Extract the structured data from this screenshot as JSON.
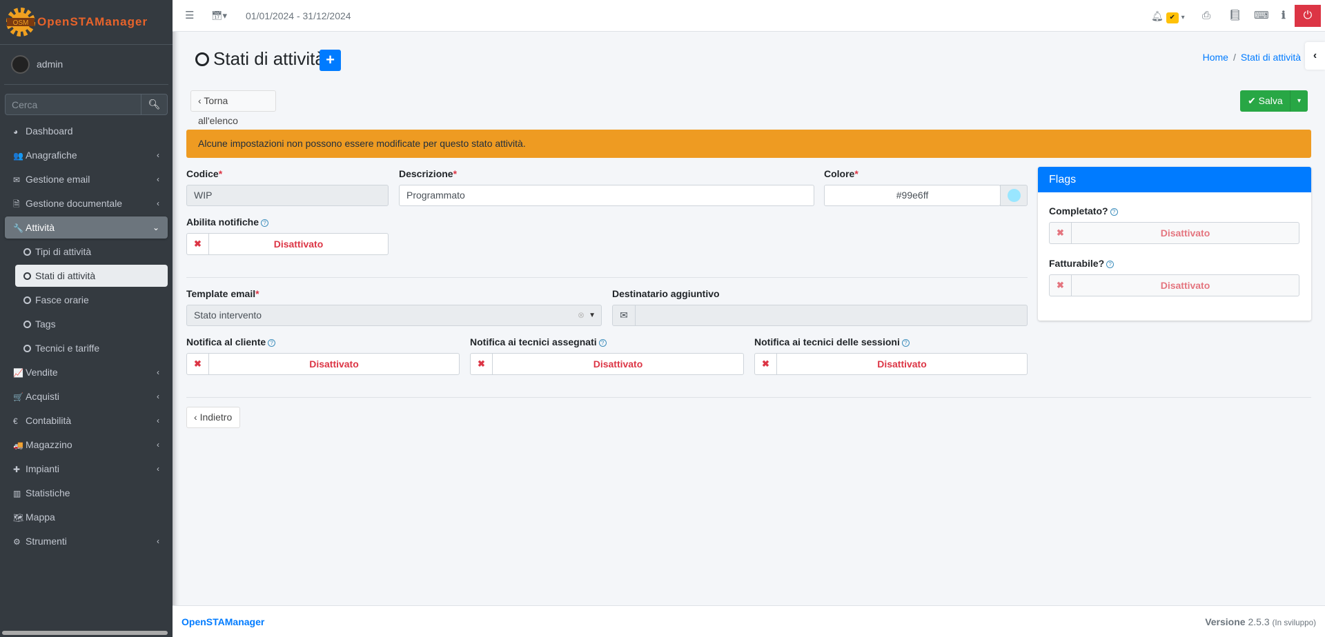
{
  "app": {
    "logo_text": "OpenSTAManager",
    "logo_badge": "OSM"
  },
  "user": {
    "name": "admin"
  },
  "search": {
    "placeholder": "Cerca"
  },
  "sidebar": {
    "items": [
      {
        "label": "Dashboard",
        "icon": "dashboard-icon",
        "glyph": "◕",
        "chevron": ""
      },
      {
        "label": "Anagrafiche",
        "icon": "users-icon",
        "glyph": "👥",
        "chevron": "‹"
      },
      {
        "label": "Gestione email",
        "icon": "envelope-icon",
        "glyph": "✉",
        "chevron": "‹"
      },
      {
        "label": "Gestione documentale",
        "icon": "file-icon",
        "glyph": "🗎",
        "chevron": "‹"
      },
      {
        "label": "Attività",
        "icon": "wrench-icon",
        "glyph": "🔧",
        "chevron": "⌄",
        "active": true
      },
      {
        "label": "Tipi di attività",
        "sub": true
      },
      {
        "label": "Stati di attività",
        "sub": true,
        "selected": true
      },
      {
        "label": "Fasce orarie",
        "sub": true
      },
      {
        "label": "Tags",
        "sub": true
      },
      {
        "label": "Tecnici e tariffe",
        "sub": true
      },
      {
        "label": "Vendite",
        "icon": "chart-line-icon",
        "glyph": "📈",
        "chevron": "‹"
      },
      {
        "label": "Acquisti",
        "icon": "cart-icon",
        "glyph": "🛒",
        "chevron": "‹"
      },
      {
        "label": "Contabilità",
        "icon": "euro-icon",
        "glyph": "€",
        "chevron": "‹"
      },
      {
        "label": "Magazzino",
        "icon": "truck-icon",
        "glyph": "🚚",
        "chevron": "‹"
      },
      {
        "label": "Impianti",
        "icon": "puzzle-icon",
        "glyph": "✚",
        "chevron": "‹"
      },
      {
        "label": "Statistiche",
        "icon": "bar-chart-icon",
        "glyph": "▥",
        "chevron": ""
      },
      {
        "label": "Mappa",
        "icon": "map-icon",
        "glyph": "🗺",
        "chevron": ""
      },
      {
        "label": "Strumenti",
        "icon": "cog-icon",
        "glyph": "⚙",
        "chevron": "‹"
      }
    ]
  },
  "topbar": {
    "date_range": "01/01/2024 - 31/12/2024"
  },
  "page": {
    "title": "Stati di attività",
    "breadcrumb": [
      "Home",
      "Stati di attività"
    ],
    "back_list": "Torna all'elenco",
    "save": "Salva",
    "back": "Indietro",
    "alert": "Alcune impostazioni non possono essere modificate per questo stato attività.",
    "alert_color": "#ee9b22"
  },
  "form": {
    "codice": {
      "label": "Codice",
      "value": "WIP"
    },
    "descrizione": {
      "label": "Descrizione",
      "value": "Programmato"
    },
    "colore": {
      "label": "Colore",
      "value": "#99e6ff"
    },
    "abilita_notifiche": {
      "label": "Abilita notifiche",
      "value": "Disattivato"
    },
    "template_email": {
      "label": "Template email",
      "value": "Stato intervento"
    },
    "destinatario": {
      "label": "Destinatario aggiuntivo",
      "value": ""
    },
    "notifica_cliente": {
      "label": "Notifica al cliente",
      "value": "Disattivato"
    },
    "notifica_tecnici": {
      "label": "Notifica ai tecnici assegnati",
      "value": "Disattivato"
    },
    "notifica_sessioni": {
      "label": "Notifica ai tecnici delle sessioni",
      "value": "Disattivato"
    }
  },
  "flags": {
    "title": "Flags",
    "completato": {
      "label": "Completato?",
      "value": "Disattivato"
    },
    "fatturabile": {
      "label": "Fatturabile?",
      "value": "Disattivato"
    }
  },
  "footer": {
    "brand": "OpenSTAManager",
    "version_label": "Versione",
    "version": "2.5.3",
    "dev": "(In sviluppo)"
  }
}
